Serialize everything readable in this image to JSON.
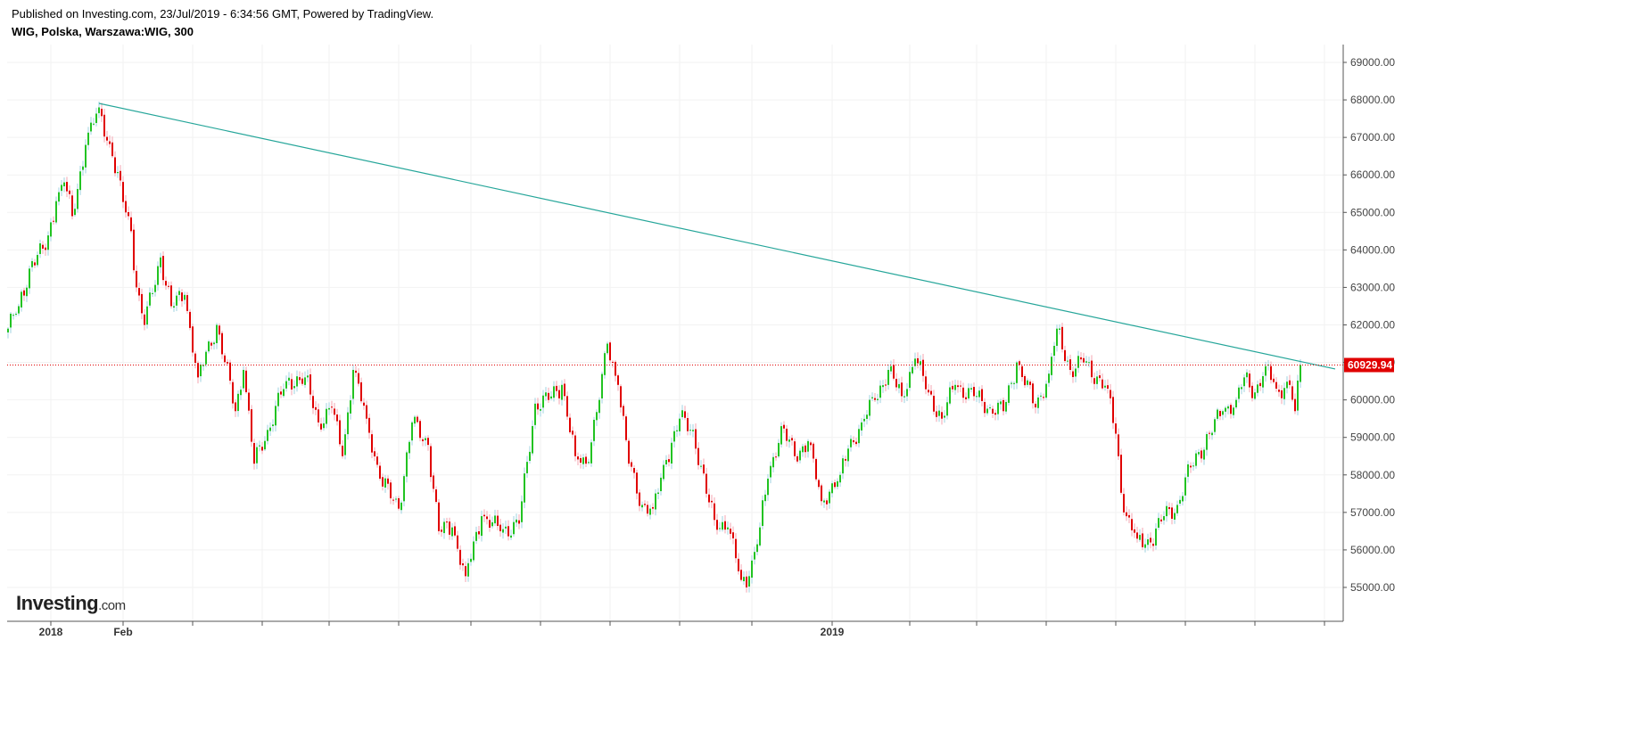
{
  "header": {
    "published": "Published on Investing.com, 23/Jul/2019 - 6:34:56 GMT, Powered by TradingView.",
    "symbol": "WIG, Polska, Warszawa:WIG, 300"
  },
  "logo": {
    "main": "Investing",
    "suffix": ".com"
  },
  "colors": {
    "up": "#22c322",
    "down": "#e00000",
    "trendline": "#26a69a",
    "price_line": "#e00000",
    "grid": "#f2f2f2"
  },
  "chart_data": {
    "type": "candlestick",
    "title": "WIG, Polska, Warszawa:WIG, 300",
    "ylim": [
      54500,
      69500
    ],
    "y_ticks": [
      "55000.00",
      "56000.00",
      "57000.00",
      "58000.00",
      "59000.00",
      "60000.00",
      "61000.00",
      "62000.00",
      "63000.00",
      "64000.00",
      "65000.00",
      "66000.00",
      "67000.00",
      "68000.00",
      "69000.00"
    ],
    "x_ticks": [
      {
        "bar": 16,
        "label": "2018"
      },
      {
        "bar": 43,
        "label": "Feb"
      },
      {
        "bar": 308,
        "label": "2019"
      }
    ],
    "x_grid_bars": [
      16,
      43,
      69,
      95,
      120,
      146,
      173,
      199,
      225,
      251,
      278,
      308,
      337,
      362,
      388,
      414,
      440,
      466,
      492
    ],
    "bar_count": 484,
    "close_keypoints": [
      [
        0,
        61900
      ],
      [
        4,
        62500
      ],
      [
        9,
        63700
      ],
      [
        14,
        64000
      ],
      [
        18,
        65300
      ],
      [
        21,
        65800
      ],
      [
        24,
        64900
      ],
      [
        29,
        66800
      ],
      [
        34,
        67800
      ],
      [
        39,
        66500
      ],
      [
        44,
        65000
      ],
      [
        46,
        64500
      ],
      [
        48,
        63000
      ],
      [
        51,
        62000
      ],
      [
        57,
        63800
      ],
      [
        61,
        62500
      ],
      [
        66,
        62800
      ],
      [
        71,
        60600
      ],
      [
        78,
        62000
      ],
      [
        85,
        59700
      ],
      [
        88,
        60800
      ],
      [
        92,
        58300
      ],
      [
        97,
        59200
      ],
      [
        104,
        60500
      ],
      [
        111,
        60600
      ],
      [
        116,
        59400
      ],
      [
        121,
        59800
      ],
      [
        125,
        58500
      ],
      [
        129,
        60800
      ],
      [
        134,
        59500
      ],
      [
        139,
        57900
      ],
      [
        146,
        57100
      ],
      [
        151,
        59400
      ],
      [
        157,
        58800
      ],
      [
        161,
        56500
      ],
      [
        166,
        56600
      ],
      [
        171,
        55300
      ],
      [
        177,
        56900
      ],
      [
        184,
        56500
      ],
      [
        191,
        56700
      ],
      [
        197,
        59900
      ],
      [
        202,
        60000
      ],
      [
        207,
        60400
      ],
      [
        212,
        58500
      ],
      [
        216,
        58300
      ],
      [
        221,
        60000
      ],
      [
        224,
        61500
      ],
      [
        228,
        60400
      ],
      [
        232,
        58300
      ],
      [
        237,
        57200
      ],
      [
        241,
        57100
      ],
      [
        246,
        58400
      ],
      [
        251,
        59500
      ],
      [
        256,
        59200
      ],
      [
        261,
        57500
      ],
      [
        264,
        56800
      ],
      [
        269,
        56600
      ],
      [
        274,
        55200
      ],
      [
        277,
        55300
      ],
      [
        281,
        56600
      ],
      [
        284,
        57900
      ],
      [
        289,
        59300
      ],
      [
        294,
        58500
      ],
      [
        299,
        58900
      ],
      [
        304,
        57300
      ],
      [
        311,
        58000
      ],
      [
        314,
        58700
      ],
      [
        319,
        59400
      ],
      [
        324,
        60000
      ],
      [
        329,
        60800
      ],
      [
        334,
        60100
      ],
      [
        339,
        61100
      ],
      [
        344,
        60200
      ],
      [
        349,
        59500
      ],
      [
        354,
        60400
      ],
      [
        361,
        60100
      ],
      [
        367,
        59800
      ],
      [
        372,
        59700
      ],
      [
        377,
        61000
      ],
      [
        384,
        59800
      ],
      [
        389,
        60700
      ],
      [
        392,
        61900
      ],
      [
        397,
        60800
      ],
      [
        402,
        61000
      ],
      [
        411,
        60300
      ],
      [
        414,
        59100
      ],
      [
        417,
        57000
      ],
      [
        422,
        56300
      ],
      [
        427,
        56200
      ],
      [
        432,
        56900
      ],
      [
        437,
        57200
      ],
      [
        442,
        58200
      ],
      [
        449,
        59100
      ],
      [
        454,
        59700
      ],
      [
        459,
        60000
      ],
      [
        462,
        60600
      ],
      [
        466,
        60200
      ],
      [
        470,
        60900
      ],
      [
        474,
        60300
      ],
      [
        479,
        60400
      ],
      [
        481,
        59700
      ],
      [
        483,
        60930
      ]
    ],
    "trendline": {
      "start": [
        34,
        67907
      ],
      "end": [
        496,
        60825
      ]
    },
    "last_price": 60929.94,
    "last_price_label": "60929.94"
  }
}
